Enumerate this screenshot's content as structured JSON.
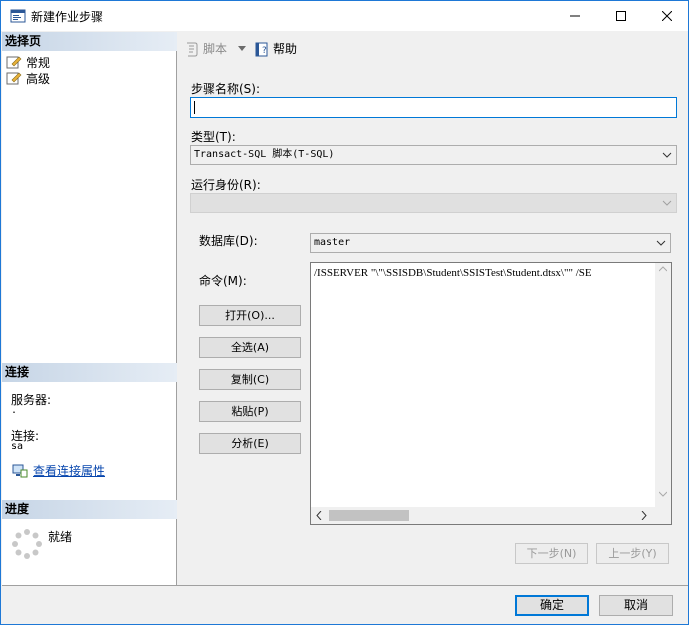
{
  "window": {
    "title": "新建作业步骤"
  },
  "left": {
    "select_page_header": "选择页",
    "pages": [
      {
        "label": "常规"
      },
      {
        "label": "高级"
      }
    ],
    "connection_header": "连接",
    "server_label": "服务器:",
    "server_value": ".",
    "connection_label": "连接:",
    "connection_value": "sa",
    "view_connection_link": "查看连接属性",
    "progress_header": "进度",
    "progress_status": "就绪"
  },
  "toolbar": {
    "script_label": "脚本",
    "help_label": "帮助"
  },
  "form": {
    "step_name_label": "步骤名称(S):",
    "step_name_value": "",
    "type_label": "类型(T):",
    "type_value": "Transact-SQL 脚本(T-SQL)",
    "run_as_label": "运行身份(R):",
    "run_as_value": "",
    "database_label": "数据库(D):",
    "database_value": "master",
    "command_label": "命令(M):",
    "command_value": "/ISSERVER \"\\\"\\SSISDB\\Student\\SSISTest\\Student.dtsx\\\"\" /SE",
    "buttons": {
      "open": "打开(O)...",
      "select_all": "全选(A)",
      "copy": "复制(C)",
      "paste": "粘贴(P)",
      "parse": "分析(E)"
    },
    "next_label": "下一步(N)",
    "prev_label": "上一步(Y)"
  },
  "footer": {
    "ok_label": "确定",
    "cancel_label": "取消"
  },
  "colors": {
    "accent": "#0078d7",
    "section_header": "#c6d5e6",
    "link": "#0645ad"
  }
}
